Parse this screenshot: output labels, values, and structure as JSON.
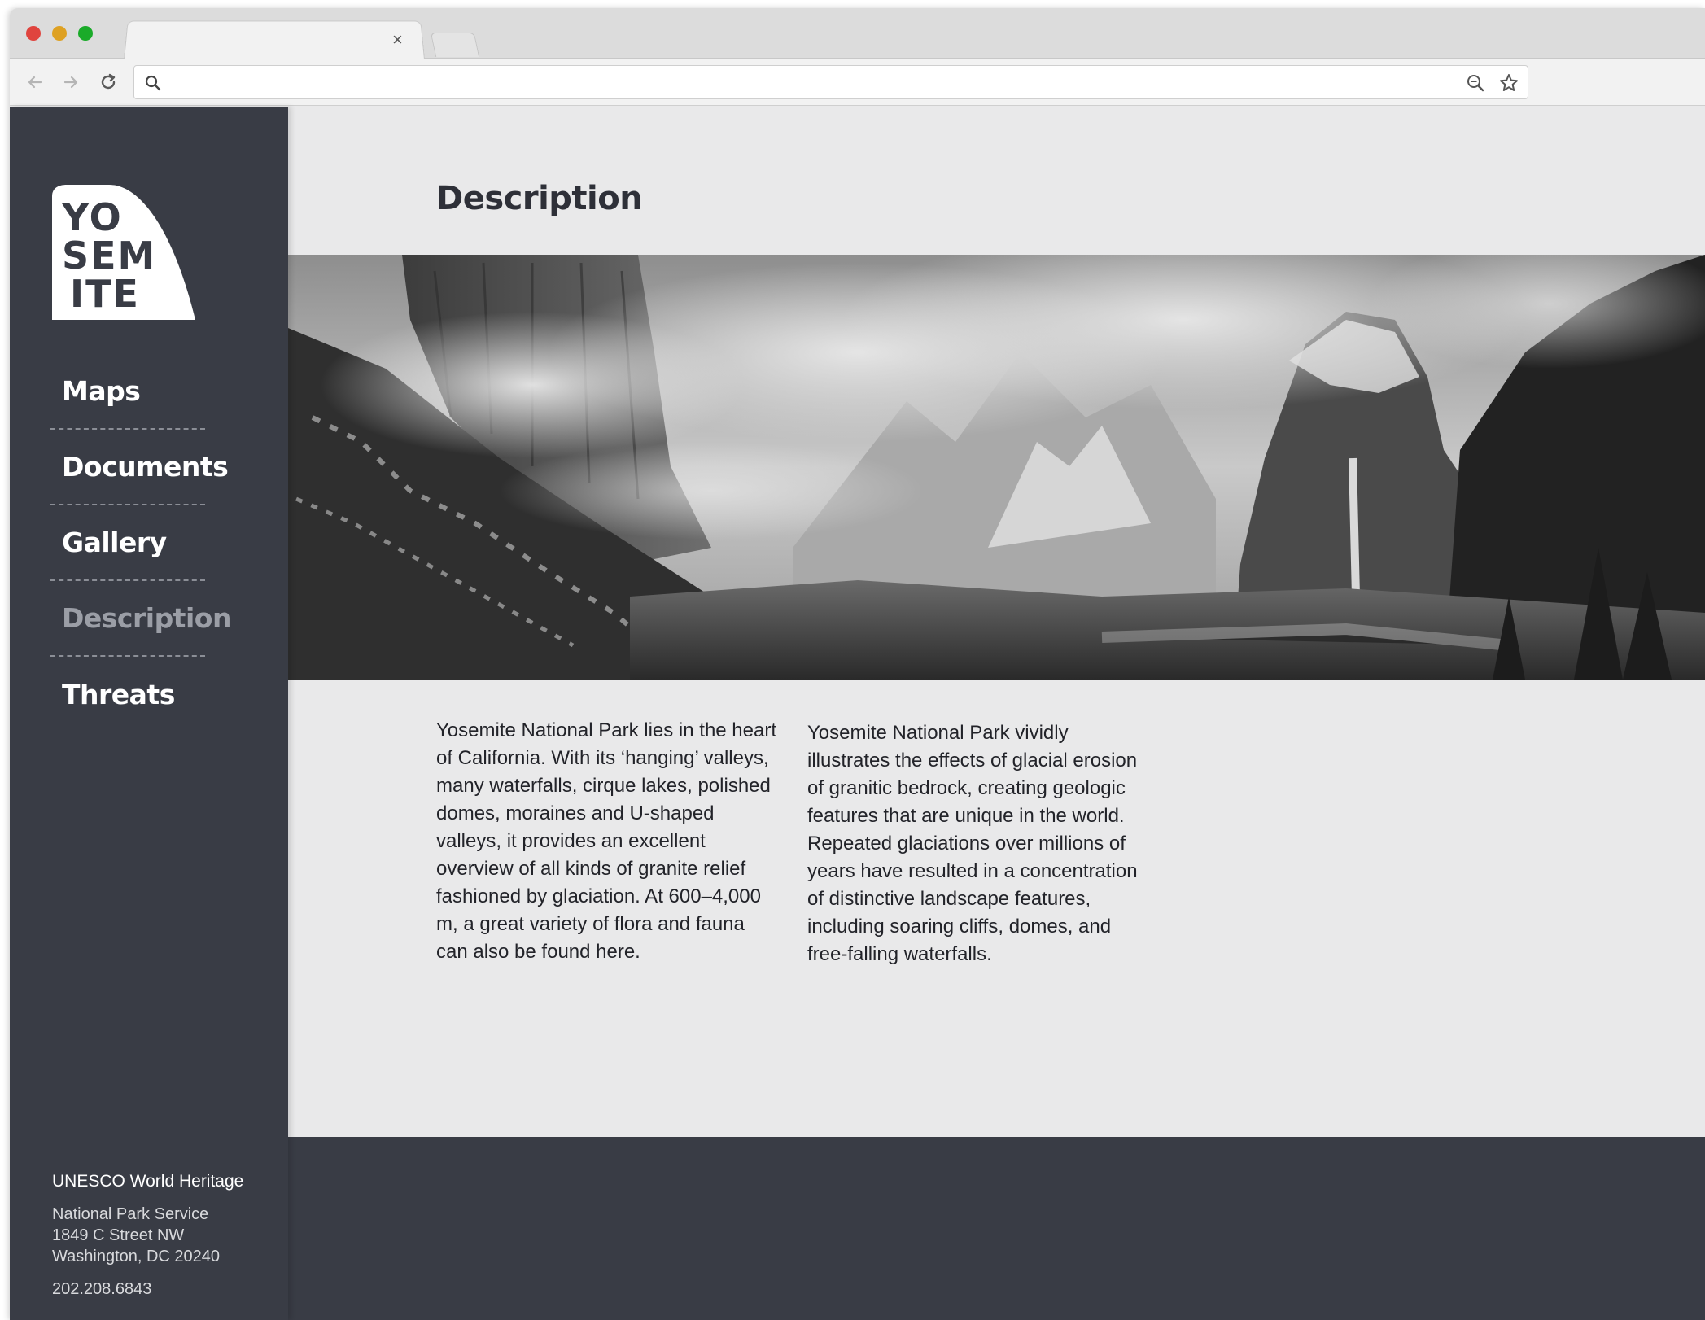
{
  "browser": {
    "tab_close_glyph": "×",
    "address_value": "",
    "address_placeholder": ""
  },
  "logo": {
    "lines": [
      "YO",
      "SEM",
      "ITE"
    ]
  },
  "sidebar": {
    "items": [
      {
        "label": "Maps",
        "active": false
      },
      {
        "label": "Documents",
        "active": false
      },
      {
        "label": "Gallery",
        "active": false
      },
      {
        "label": "Description",
        "active": true
      },
      {
        "label": "Threats",
        "active": false
      }
    ],
    "footer": {
      "org": "UNESCO World Heritage",
      "address_line1": "National Park Service",
      "address_line2": "1849 C Street NW",
      "address_line3": "Washington, DC 20240",
      "phone": "202.208.6843"
    }
  },
  "main": {
    "title": "Description",
    "paragraph_left": "Yosemite National Park lies in the heart of California. With its ‘hanging’ valleys, many waterfalls, cirque lakes, polished domes, moraines and U-shaped valleys, it provides an excellent overview of all kinds of granite relief fashioned by glaciation. At 600–4,000 m, a great variety of flora and fauna can also be found here.",
    "paragraph_right": "Yosemite National Park vividly illustrates the effects of glacial erosion of granitic bedrock, creating geologic features that are unique in the world. Repeated glaciations over millions of years have resulted in a concentration of distinctive landscape features, including soaring cliffs, domes, and free-falling waterfalls."
  },
  "colors": {
    "sidebar_bg": "#393c45",
    "page_bg": "#e9e9ea",
    "active_nav": "#9b9ea6"
  }
}
